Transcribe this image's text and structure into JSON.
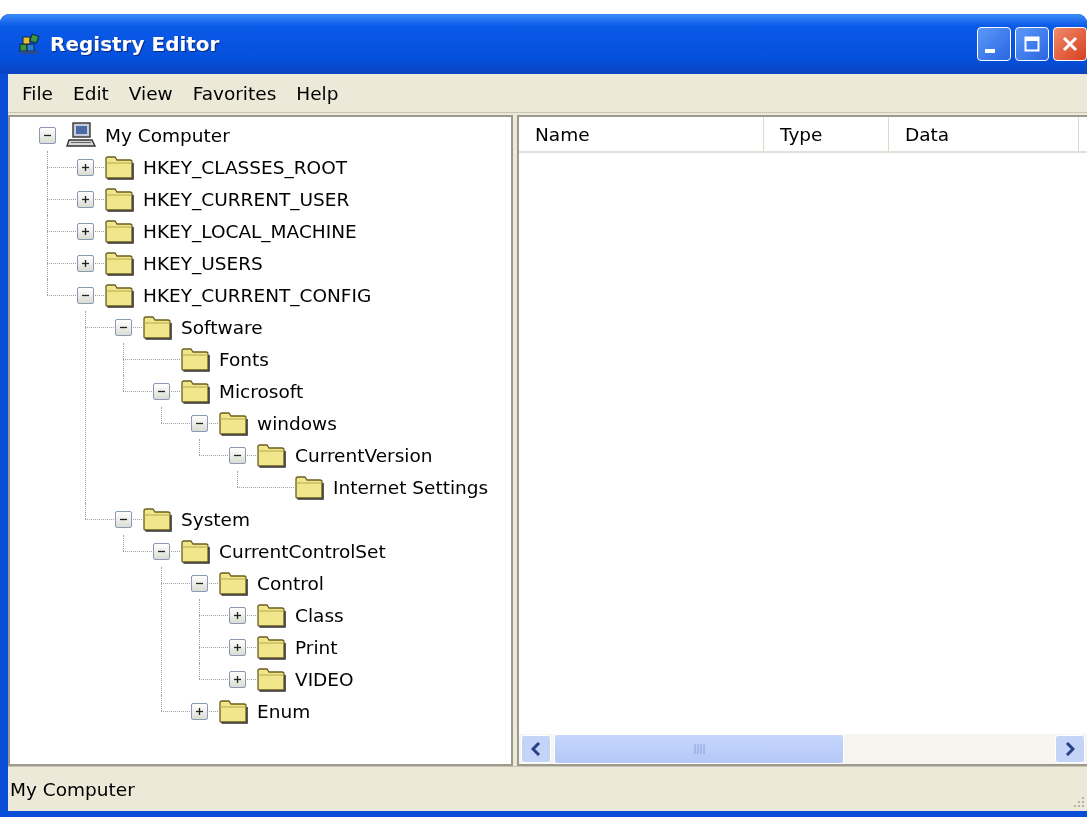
{
  "window": {
    "title": "Registry Editor"
  },
  "menu": [
    {
      "label": "File"
    },
    {
      "label": "Edit"
    },
    {
      "label": "View"
    },
    {
      "label": "Favorites"
    },
    {
      "label": "Help"
    }
  ],
  "tree": [
    {
      "label": "My Computer",
      "kind": "computer",
      "expanded": true,
      "children": [
        {
          "label": "HKEY_CLASSES_ROOT",
          "kind": "folder",
          "expanded": false
        },
        {
          "label": "HKEY_CURRENT_USER",
          "kind": "folder",
          "expanded": false
        },
        {
          "label": "HKEY_LOCAL_MACHINE",
          "kind": "folder",
          "expanded": false
        },
        {
          "label": "HKEY_USERS",
          "kind": "folder",
          "expanded": false
        },
        {
          "label": "HKEY_CURRENT_CONFIG",
          "kind": "folder",
          "expanded": true,
          "children": [
            {
              "label": "Software",
              "kind": "folder",
              "expanded": true,
              "children": [
                {
                  "label": "Fonts",
                  "kind": "folder"
                },
                {
                  "label": "Microsoft",
                  "kind": "folder",
                  "expanded": true,
                  "children": [
                    {
                      "label": "windows",
                      "kind": "folder",
                      "expanded": true,
                      "children": [
                        {
                          "label": "CurrentVersion",
                          "kind": "folder",
                          "expanded": true,
                          "children": [
                            {
                              "label": "Internet Settings",
                              "kind": "folder"
                            }
                          ]
                        }
                      ]
                    }
                  ]
                }
              ]
            },
            {
              "label": "System",
              "kind": "folder",
              "expanded": true,
              "children": [
                {
                  "label": "CurrentControlSet",
                  "kind": "folder",
                  "expanded": true,
                  "children": [
                    {
                      "label": "Control",
                      "kind": "folder",
                      "expanded": true,
                      "children": [
                        {
                          "label": "Class",
                          "kind": "folder",
                          "expanded": false
                        },
                        {
                          "label": "Print",
                          "kind": "folder",
                          "expanded": false
                        },
                        {
                          "label": "VIDEO",
                          "kind": "folder",
                          "expanded": false
                        }
                      ]
                    },
                    {
                      "label": "Enum",
                      "kind": "folder",
                      "expanded": false
                    }
                  ]
                }
              ]
            }
          ]
        }
      ]
    }
  ],
  "list": {
    "columns": [
      "Name",
      "Type",
      "Data"
    ]
  },
  "status_bar": {
    "text": "My Computer"
  }
}
